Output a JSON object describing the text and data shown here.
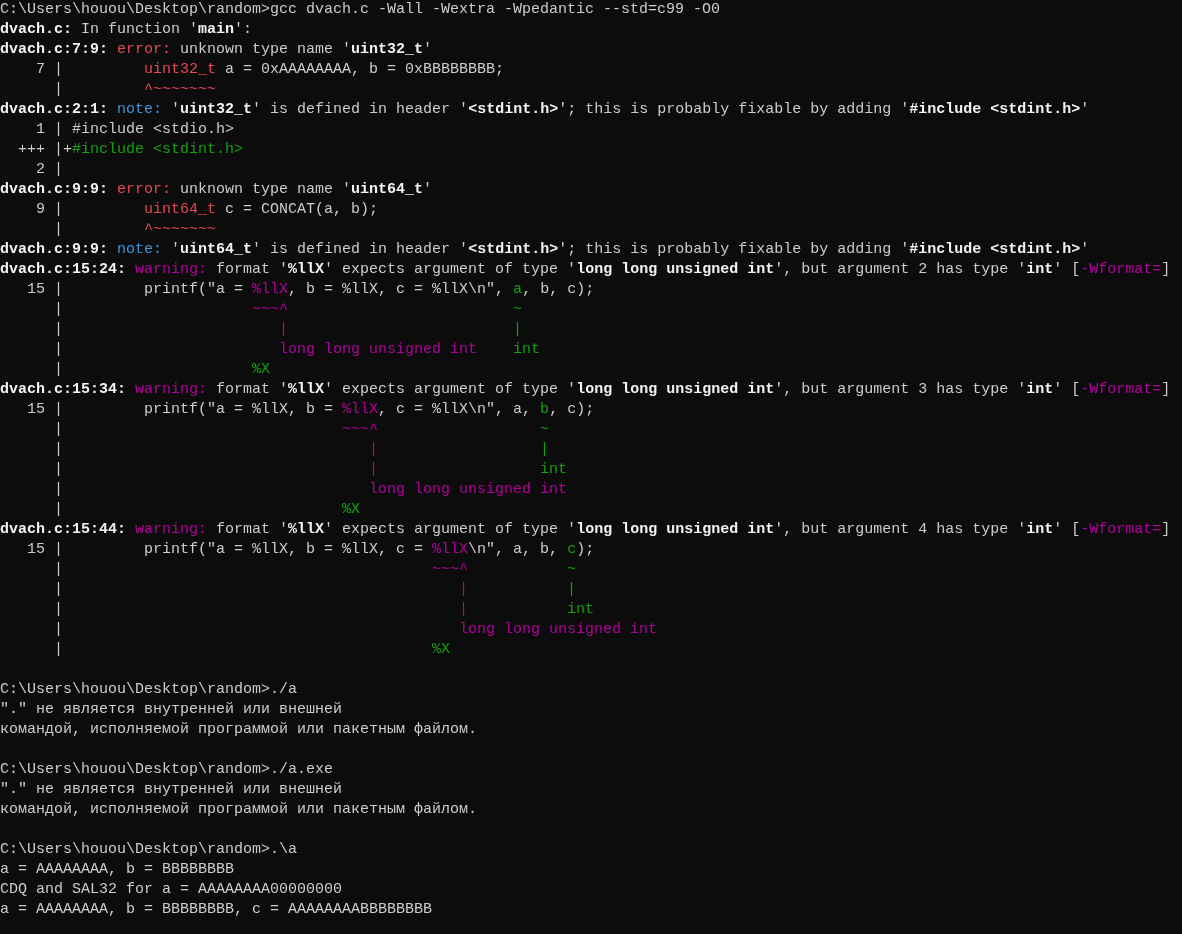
{
  "terminal": {
    "blocks": [
      {
        "lines": [
          {
            "segments": [
              {
                "text": "C:\\Users\\houou\\Desktop\\random>gcc dvach.c -Wall -Wextra -Wpedantic --std=c99 -O0",
                "kind": "plain"
              }
            ]
          },
          {
            "segments": [
              {
                "text": "dvach.c:",
                "kind": "bold"
              },
              {
                "text": " In function '",
                "kind": "plain"
              },
              {
                "text": "main",
                "kind": "bold"
              },
              {
                "text": "':",
                "kind": "plain"
              }
            ]
          },
          {
            "segments": [
              {
                "text": "dvach.c:7:9:",
                "kind": "bold"
              },
              {
                "text": " error:",
                "kind": "error"
              },
              {
                "text": " unknown type name '",
                "kind": "plain"
              },
              {
                "text": "uint32_t",
                "kind": "bold"
              },
              {
                "text": "'",
                "kind": "plain"
              }
            ]
          },
          {
            "segments": [
              {
                "text": "    7 |         ",
                "kind": "plain"
              },
              {
                "text": "uint32_t",
                "kind": "error"
              },
              {
                "text": " a = 0xAAAAAAAA, b = 0xBBBBBBBB;",
                "kind": "plain"
              }
            ]
          },
          {
            "segments": [
              {
                "text": "      |         ",
                "kind": "plain"
              },
              {
                "text": "^~~~~~~~",
                "kind": "error"
              }
            ]
          },
          {
            "segments": [
              {
                "text": "dvach.c:2:1:",
                "kind": "bold"
              },
              {
                "text": " note:",
                "kind": "note"
              },
              {
                "text": " '",
                "kind": "plain"
              },
              {
                "text": "uint32_t",
                "kind": "bold"
              },
              {
                "text": "' is defined in header '",
                "kind": "plain"
              },
              {
                "text": "<stdint.h>",
                "kind": "bold"
              },
              {
                "text": "'; this is probably fixable by adding '",
                "kind": "plain"
              },
              {
                "text": "#include <stdint.h>",
                "kind": "bold"
              },
              {
                "text": "'",
                "kind": "plain"
              }
            ]
          },
          {
            "segments": [
              {
                "text": "    1 | #include <stdio.h>",
                "kind": "plain"
              }
            ]
          },
          {
            "segments": [
              {
                "text": "  +++ |+",
                "kind": "plain"
              },
              {
                "text": "#include <stdint.h>",
                "kind": "fix"
              }
            ]
          },
          {
            "segments": [
              {
                "text": "    2 |",
                "kind": "plain"
              }
            ]
          },
          {
            "segments": [
              {
                "text": "dvach.c:9:9:",
                "kind": "bold"
              },
              {
                "text": " error:",
                "kind": "error"
              },
              {
                "text": " unknown type name '",
                "kind": "plain"
              },
              {
                "text": "uint64_t",
                "kind": "bold"
              },
              {
                "text": "'",
                "kind": "plain"
              }
            ]
          },
          {
            "segments": [
              {
                "text": "    9 |         ",
                "kind": "plain"
              },
              {
                "text": "uint64_t",
                "kind": "error"
              },
              {
                "text": " c = CONCAT(a, b);",
                "kind": "plain"
              }
            ]
          },
          {
            "segments": [
              {
                "text": "      |         ",
                "kind": "plain"
              },
              {
                "text": "^~~~~~~~",
                "kind": "error"
              }
            ]
          },
          {
            "segments": [
              {
                "text": "dvach.c:9:9:",
                "kind": "bold"
              },
              {
                "text": " note:",
                "kind": "note"
              },
              {
                "text": " '",
                "kind": "plain"
              },
              {
                "text": "uint64_t",
                "kind": "bold"
              },
              {
                "text": "' is defined in header '",
                "kind": "plain"
              },
              {
                "text": "<stdint.h>",
                "kind": "bold"
              },
              {
                "text": "'; this is probably fixable by adding '",
                "kind": "plain"
              },
              {
                "text": "#include <stdint.h>",
                "kind": "bold"
              },
              {
                "text": "'",
                "kind": "plain"
              }
            ]
          },
          {
            "segments": [
              {
                "text": "dvach.c:15:24:",
                "kind": "bold"
              },
              {
                "text": " warning:",
                "kind": "warning"
              },
              {
                "text": " format '",
                "kind": "plain"
              },
              {
                "text": "%llX",
                "kind": "bold"
              },
              {
                "text": "' expects argument of type '",
                "kind": "plain"
              },
              {
                "text": "long long unsigned int",
                "kind": "bold"
              },
              {
                "text": "', but argument 2 has type '",
                "kind": "plain"
              },
              {
                "text": "int",
                "kind": "bold"
              },
              {
                "text": "' [",
                "kind": "plain"
              },
              {
                "text": "-Wformat=",
                "kind": "warning"
              },
              {
                "text": "]",
                "kind": "plain"
              }
            ]
          },
          {
            "segments": [
              {
                "text": "   15 |         printf(\"a = ",
                "kind": "plain"
              },
              {
                "text": "%llX",
                "kind": "warning"
              },
              {
                "text": ", b = %llX, c = %llX\\n\", ",
                "kind": "plain"
              },
              {
                "text": "a",
                "kind": "fix"
              },
              {
                "text": ", b, c);",
                "kind": "plain"
              }
            ]
          },
          {
            "segments": [
              {
                "text": "      |                     ",
                "kind": "plain"
              },
              {
                "text": "~~~^",
                "kind": "warning"
              },
              {
                "text": "                         ~",
                "kind": "fix"
              }
            ]
          },
          {
            "segments": [
              {
                "text": "      |                        ",
                "kind": "plain"
              },
              {
                "text": "|",
                "kind": "warning"
              },
              {
                "text": "                         |",
                "kind": "fix"
              }
            ]
          },
          {
            "segments": [
              {
                "text": "      |                        ",
                "kind": "plain"
              },
              {
                "text": "long long unsigned int",
                "kind": "warning"
              },
              {
                "text": "    int",
                "kind": "fix"
              }
            ]
          },
          {
            "segments": [
              {
                "text": "      |                     ",
                "kind": "plain"
              },
              {
                "text": "%X",
                "kind": "fix"
              }
            ]
          },
          {
            "segments": [
              {
                "text": "dvach.c:15:34:",
                "kind": "bold"
              },
              {
                "text": " warning:",
                "kind": "warning"
              },
              {
                "text": " format '",
                "kind": "plain"
              },
              {
                "text": "%llX",
                "kind": "bold"
              },
              {
                "text": "' expects argument of type '",
                "kind": "plain"
              },
              {
                "text": "long long unsigned int",
                "kind": "bold"
              },
              {
                "text": "', but argument 3 has type '",
                "kind": "plain"
              },
              {
                "text": "int",
                "kind": "bold"
              },
              {
                "text": "' [",
                "kind": "plain"
              },
              {
                "text": "-Wformat=",
                "kind": "warning"
              },
              {
                "text": "]",
                "kind": "plain"
              }
            ]
          },
          {
            "segments": [
              {
                "text": "   15 |         printf(\"a = %llX, b = ",
                "kind": "plain"
              },
              {
                "text": "%llX",
                "kind": "warning"
              },
              {
                "text": ", c = %llX\\n\", a, ",
                "kind": "plain"
              },
              {
                "text": "b",
                "kind": "fix"
              },
              {
                "text": ", c);",
                "kind": "plain"
              }
            ]
          },
          {
            "segments": [
              {
                "text": "      |                               ",
                "kind": "plain"
              },
              {
                "text": "~~~^",
                "kind": "warning"
              },
              {
                "text": "                  ~",
                "kind": "fix"
              }
            ]
          },
          {
            "segments": [
              {
                "text": "      |                                  ",
                "kind": "plain"
              },
              {
                "text": "|",
                "kind": "warning"
              },
              {
                "text": "                  |",
                "kind": "fix"
              }
            ]
          },
          {
            "segments": [
              {
                "text": "      |                                  ",
                "kind": "plain"
              },
              {
                "text": "|",
                "kind": "warning"
              },
              {
                "text": "                  int",
                "kind": "fix"
              }
            ]
          },
          {
            "segments": [
              {
                "text": "      |                                  ",
                "kind": "plain"
              },
              {
                "text": "long long unsigned int",
                "kind": "warning"
              }
            ]
          },
          {
            "segments": [
              {
                "text": "      |                               ",
                "kind": "plain"
              },
              {
                "text": "%X",
                "kind": "fix"
              }
            ]
          },
          {
            "segments": [
              {
                "text": "dvach.c:15:44:",
                "kind": "bold"
              },
              {
                "text": " warning:",
                "kind": "warning"
              },
              {
                "text": " format '",
                "kind": "plain"
              },
              {
                "text": "%llX",
                "kind": "bold"
              },
              {
                "text": "' expects argument of type '",
                "kind": "plain"
              },
              {
                "text": "long long unsigned int",
                "kind": "bold"
              },
              {
                "text": "', but argument 4 has type '",
                "kind": "plain"
              },
              {
                "text": "int",
                "kind": "bold"
              },
              {
                "text": "' [",
                "kind": "plain"
              },
              {
                "text": "-Wformat=",
                "kind": "warning"
              },
              {
                "text": "]",
                "kind": "plain"
              }
            ]
          },
          {
            "segments": [
              {
                "text": "   15 |         printf(\"a = %llX, b = %llX, c = ",
                "kind": "plain"
              },
              {
                "text": "%llX",
                "kind": "warning"
              },
              {
                "text": "\\n\", a, b, ",
                "kind": "plain"
              },
              {
                "text": "c",
                "kind": "fix"
              },
              {
                "text": ");",
                "kind": "plain"
              }
            ]
          },
          {
            "segments": [
              {
                "text": "      |                                         ",
                "kind": "plain"
              },
              {
                "text": "~~~^",
                "kind": "warning"
              },
              {
                "text": "           ~",
                "kind": "fix"
              }
            ]
          },
          {
            "segments": [
              {
                "text": "      |                                            ",
                "kind": "plain"
              },
              {
                "text": "|",
                "kind": "warning"
              },
              {
                "text": "           |",
                "kind": "fix"
              }
            ]
          },
          {
            "segments": [
              {
                "text": "      |                                            ",
                "kind": "plain"
              },
              {
                "text": "|",
                "kind": "warning"
              },
              {
                "text": "           int",
                "kind": "fix"
              }
            ]
          },
          {
            "segments": [
              {
                "text": "      |                                            ",
                "kind": "plain"
              },
              {
                "text": "long long unsigned int",
                "kind": "warning"
              }
            ]
          },
          {
            "segments": [
              {
                "text": "      |                                         ",
                "kind": "plain"
              },
              {
                "text": "%X",
                "kind": "fix"
              }
            ]
          }
        ]
      },
      {
        "lines": [
          {
            "segments": [
              {
                "text": "C:\\Users\\houou\\Desktop\\random>./a",
                "kind": "plain"
              }
            ]
          },
          {
            "segments": [
              {
                "text": "\".\" не является внутренней или внешней",
                "kind": "plain"
              }
            ]
          },
          {
            "segments": [
              {
                "text": "командой, исполняемой программой или пакетным файлом.",
                "kind": "plain"
              }
            ]
          }
        ]
      },
      {
        "lines": [
          {
            "segments": [
              {
                "text": "C:\\Users\\houou\\Desktop\\random>./a.exe",
                "kind": "plain"
              }
            ]
          },
          {
            "segments": [
              {
                "text": "\".\" не является внутренней или внешней",
                "kind": "plain"
              }
            ]
          },
          {
            "segments": [
              {
                "text": "командой, исполняемой программой или пакетным файлом.",
                "kind": "plain"
              }
            ]
          }
        ]
      },
      {
        "lines": [
          {
            "segments": [
              {
                "text": "C:\\Users\\houou\\Desktop\\random>.\\a",
                "kind": "plain"
              }
            ]
          },
          {
            "segments": [
              {
                "text": "a = AAAAAAAA, b = BBBBBBBB",
                "kind": "plain"
              }
            ]
          },
          {
            "segments": [
              {
                "text": "CDQ and SAL32 for a = AAAAAAAA00000000",
                "kind": "plain"
              }
            ]
          },
          {
            "segments": [
              {
                "text": "a = AAAAAAAA, b = BBBBBBBB, c = AAAAAAAABBBBBBBB",
                "kind": "plain"
              }
            ]
          }
        ]
      }
    ]
  }
}
